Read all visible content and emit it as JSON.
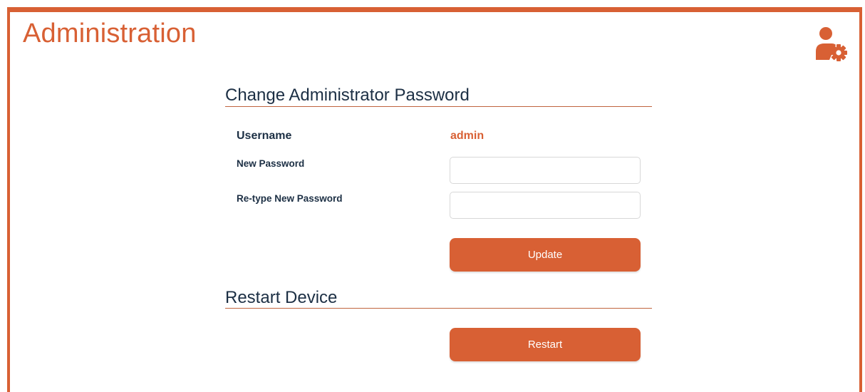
{
  "header": {
    "title": "Administration",
    "icon": "admin-user-gear-icon"
  },
  "theme": {
    "accent": "#d86034",
    "heading_text": "#1c2f44"
  },
  "change_password": {
    "title": "Change Administrator Password",
    "username_label": "Username",
    "username_value": "admin",
    "new_password_label": "New Password",
    "new_password_value": "",
    "retype_password_label": "Re-type New Password",
    "retype_password_value": "",
    "update_button": "Update"
  },
  "restart": {
    "title": "Restart Device",
    "restart_button": "Restart"
  }
}
